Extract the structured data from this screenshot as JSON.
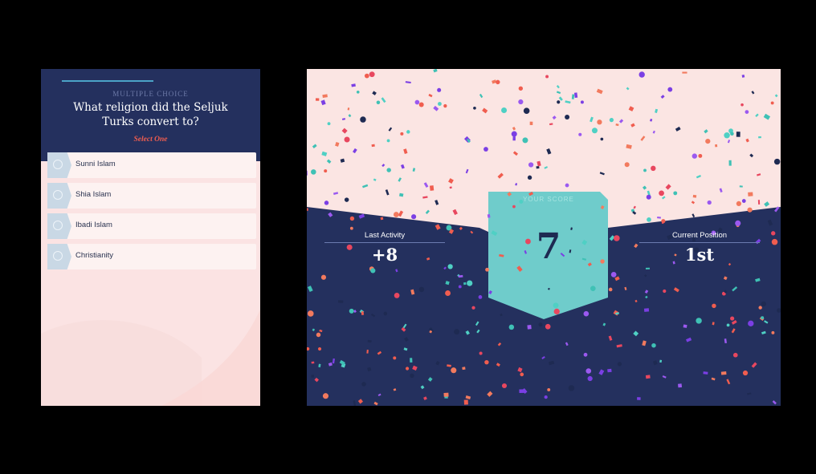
{
  "quiz": {
    "kind": "MULTIPLE CHOICE",
    "question": "What religion did the Seljuk Turks convert to?",
    "hint": "Select One",
    "options": [
      {
        "label": "Sunni Islam"
      },
      {
        "label": "Shia Islam"
      },
      {
        "label": "Ibadi Islam"
      },
      {
        "label": "Christianity"
      }
    ]
  },
  "score": {
    "badge_label": "YOUR SCORE",
    "badge_value": "7",
    "last_activity": {
      "label": "Last Activity",
      "value": "+8"
    },
    "current_position": {
      "label": "Current Position",
      "value": "1st"
    }
  },
  "colors": {
    "navy": "#24305e",
    "pink": "#fbe4e4",
    "teal": "#6fcccb",
    "coral": "#f05d4f"
  }
}
